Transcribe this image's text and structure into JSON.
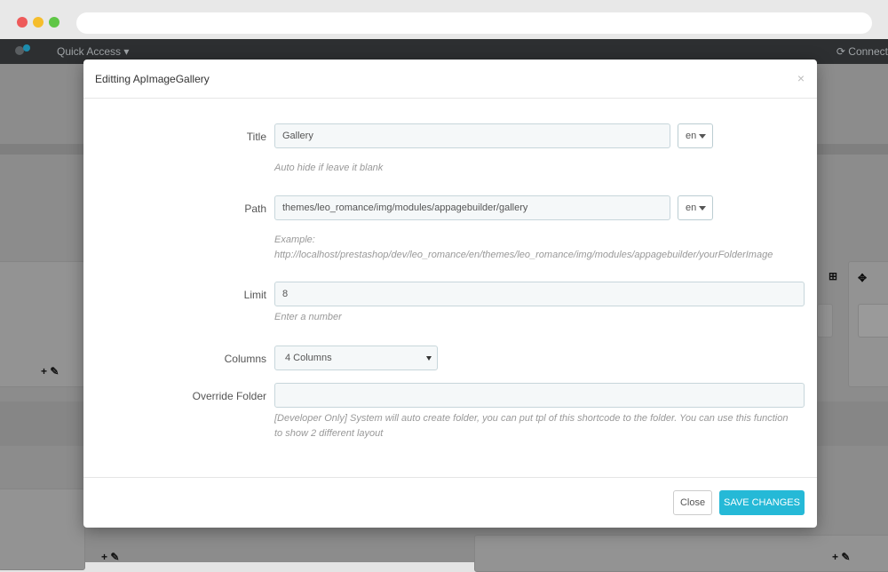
{
  "header": {
    "quick_access": "Quick Access",
    "connect": "Connect"
  },
  "background": {
    "icons": "+ ✎"
  },
  "modal": {
    "title": "Editting ApImageGallery",
    "close_symbol": "×",
    "fields": {
      "title": {
        "label": "Title",
        "value": "Gallery",
        "lang": "en",
        "help": "Auto hide if leave it blank"
      },
      "path": {
        "label": "Path",
        "value": "themes/leo_romance/img/modules/appagebuilder/gallery",
        "lang": "en",
        "help_line1": "Example:",
        "help_line2": "http://localhost/prestashop/dev/leo_romance/en/themes/leo_romance/img/modules/appagebuilder/yourFolderImage"
      },
      "limit": {
        "label": "Limit",
        "value": "8",
        "help": "Enter a number"
      },
      "columns": {
        "label": "Columns",
        "selected": "4 Columns"
      },
      "override_folder": {
        "label": "Override Folder",
        "value": "",
        "help": "[Developer Only] System will auto create folder, you can put tpl of this shortcode to the folder. You can use this function to show 2 different layout"
      }
    },
    "footer": {
      "close": "Close",
      "save": "SAVE CHANGES"
    }
  }
}
